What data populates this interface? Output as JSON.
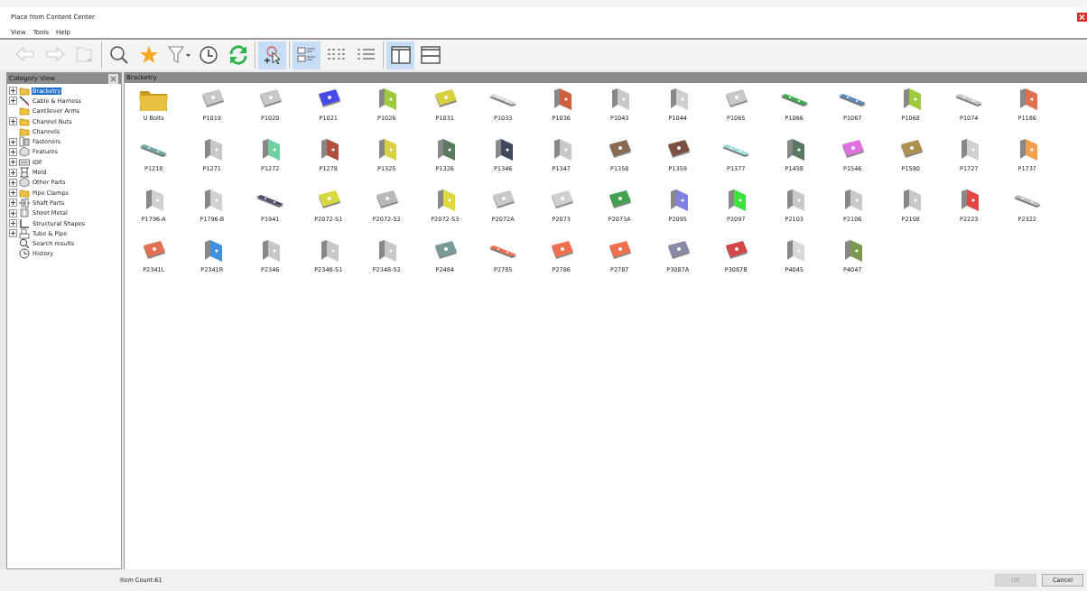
{
  "window": {
    "title": "Place from Content Center"
  },
  "menu": [
    "View",
    "Tools",
    "Help"
  ],
  "toolbar": [
    {
      "kind": "back",
      "disabled": true,
      "selected": false
    },
    {
      "kind": "forward",
      "disabled": true,
      "selected": false
    },
    {
      "kind": "folderup",
      "disabled": true,
      "selected": false
    },
    {
      "kind": "separator"
    },
    {
      "kind": "search",
      "disabled": false,
      "selected": false
    },
    {
      "kind": "star",
      "disabled": false,
      "selected": false
    },
    {
      "kind": "filter",
      "disabled": false,
      "selected": false
    },
    {
      "kind": "clock",
      "disabled": false,
      "selected": false
    },
    {
      "kind": "refresh",
      "disabled": false,
      "selected": false
    },
    {
      "kind": "separator"
    },
    {
      "kind": "place",
      "disabled": false,
      "selected": true
    },
    {
      "kind": "separator"
    },
    {
      "kind": "largelist",
      "disabled": false,
      "selected": true
    },
    {
      "kind": "smalllist",
      "disabled": false,
      "selected": false
    },
    {
      "kind": "detaillist",
      "disabled": false,
      "selected": false
    },
    {
      "kind": "separator"
    },
    {
      "kind": "splitvertical",
      "disabled": false,
      "selected": true
    },
    {
      "kind": "splithorizontal",
      "disabled": false,
      "selected": false
    }
  ],
  "sidebar": {
    "title": "Category View",
    "items": [
      {
        "label": "Bracketry",
        "kind": "folder",
        "expandable": true,
        "selected": true
      },
      {
        "label": "Cable & Harness",
        "kind": "cable",
        "expandable": true,
        "selected": false
      },
      {
        "label": "Cantilever Arms",
        "kind": "folder",
        "expandable": false,
        "selected": false
      },
      {
        "label": "Channel Nuts",
        "kind": "folder",
        "expandable": true,
        "selected": false
      },
      {
        "label": "Channels",
        "kind": "folder",
        "expandable": false,
        "selected": false
      },
      {
        "label": "Fasteners",
        "kind": "fastener",
        "expandable": true,
        "selected": false
      },
      {
        "label": "Features",
        "kind": "feature",
        "expandable": true,
        "selected": false
      },
      {
        "label": "IDF",
        "kind": "idf",
        "expandable": true,
        "selected": false
      },
      {
        "label": "Mold",
        "kind": "mold",
        "expandable": true,
        "selected": false
      },
      {
        "label": "Other Parts",
        "kind": "feature",
        "expandable": true,
        "selected": false
      },
      {
        "label": "Pipe Clamps",
        "kind": "folder",
        "expandable": true,
        "selected": false
      },
      {
        "label": "Shaft Parts",
        "kind": "shaft",
        "expandable": true,
        "selected": false
      },
      {
        "label": "Sheet Metal",
        "kind": "sheet",
        "expandable": true,
        "selected": false
      },
      {
        "label": "Structural Shapes",
        "kind": "structural",
        "expandable": true,
        "selected": false
      },
      {
        "label": "Tube & Pipe",
        "kind": "tube",
        "expandable": true,
        "selected": false
      },
      {
        "label": "Search results",
        "kind": "search",
        "expandable": false,
        "selected": false
      },
      {
        "label": "History",
        "kind": "history",
        "expandable": false,
        "selected": false
      }
    ]
  },
  "content": {
    "title": "Bracketry",
    "items": [
      {
        "label": "U Bolts",
        "kind": "folder",
        "color": "#e8c040"
      },
      {
        "label": "P1019",
        "kind": "plate",
        "color": "#c8c8c8"
      },
      {
        "label": "P1020",
        "kind": "plate",
        "color": "#c8c8c8"
      },
      {
        "label": "P1021",
        "kind": "plate",
        "color": "#4a4ae8"
      },
      {
        "label": "P1026",
        "kind": "angle",
        "color": "#9ccc3c"
      },
      {
        "label": "P1031",
        "kind": "plate",
        "color": "#d8d040"
      },
      {
        "label": "P1033",
        "kind": "strip",
        "color": "#d8d8d8"
      },
      {
        "label": "P1036",
        "kind": "angle",
        "color": "#d0603c"
      },
      {
        "label": "P1043",
        "kind": "angle",
        "color": "#c8c8c8"
      },
      {
        "label": "P1044",
        "kind": "angle",
        "color": "#d0d0d0"
      },
      {
        "label": "P1065",
        "kind": "plate",
        "color": "#c8c8c8"
      },
      {
        "label": "P1066",
        "kind": "strip",
        "color": "#3cb04c"
      },
      {
        "label": "P1067",
        "kind": "strip",
        "color": "#5a8cc0"
      },
      {
        "label": "P1068",
        "kind": "angle",
        "color": "#9ccc3c"
      },
      {
        "label": "P1074",
        "kind": "strip",
        "color": "#c8c8c8"
      },
      {
        "label": "P1186",
        "kind": "angle",
        "color": "#e07050"
      },
      {
        "label": "P1218",
        "kind": "strip",
        "color": "#70a8a8"
      },
      {
        "label": "P1271",
        "kind": "angle",
        "color": "#c8c8c8"
      },
      {
        "label": "P1272",
        "kind": "angle",
        "color": "#70d0a0"
      },
      {
        "label": "P1278",
        "kind": "angle",
        "color": "#b05040"
      },
      {
        "label": "P1325",
        "kind": "angle",
        "color": "#d8d040"
      },
      {
        "label": "P1326",
        "kind": "angle",
        "color": "#5a7a60"
      },
      {
        "label": "P1346",
        "kind": "angle",
        "color": "#404860"
      },
      {
        "label": "P1347",
        "kind": "angle",
        "color": "#c8c8c8"
      },
      {
        "label": "P1358",
        "kind": "plate",
        "color": "#8a6a50"
      },
      {
        "label": "P1359",
        "kind": "plate",
        "color": "#7a5040"
      },
      {
        "label": "P1377",
        "kind": "strip",
        "color": "#a0dcdc"
      },
      {
        "label": "P1458",
        "kind": "angle",
        "color": "#5a7a60"
      },
      {
        "label": "P1546",
        "kind": "plate",
        "color": "#e070e0"
      },
      {
        "label": "P1580",
        "kind": "plate",
        "color": "#b09050"
      },
      {
        "label": "P1727",
        "kind": "angle",
        "color": "#d0d0d0"
      },
      {
        "label": "P1737",
        "kind": "angle",
        "color": "#f0a050"
      },
      {
        "label": "P1796-A",
        "kind": "angle",
        "color": "#d0d0d0"
      },
      {
        "label": "P1796-B",
        "kind": "angle",
        "color": "#d0d0d0"
      },
      {
        "label": "P1941",
        "kind": "strip",
        "color": "#505070"
      },
      {
        "label": "P2072-S1",
        "kind": "plate",
        "color": "#d8d840"
      },
      {
        "label": "P2072-S2",
        "kind": "plate",
        "color": "#b8b8b8"
      },
      {
        "label": "P2072-S3",
        "kind": "angle",
        "color": "#e0d840"
      },
      {
        "label": "P2072A",
        "kind": "plate",
        "color": "#c8c8c8"
      },
      {
        "label": "P2073",
        "kind": "plate",
        "color": "#d0d0d0"
      },
      {
        "label": "P2073A",
        "kind": "plate",
        "color": "#40a050"
      },
      {
        "label": "P2095",
        "kind": "angle",
        "color": "#8080e0"
      },
      {
        "label": "P2097",
        "kind": "angle",
        "color": "#40e040"
      },
      {
        "label": "P2103",
        "kind": "angle",
        "color": "#c8c8c8"
      },
      {
        "label": "P2106",
        "kind": "angle",
        "color": "#c8c8c8"
      },
      {
        "label": "P2108",
        "kind": "angle",
        "color": "#c8c8c8"
      },
      {
        "label": "P2223",
        "kind": "angle",
        "color": "#e04848"
      },
      {
        "label": "P2322",
        "kind": "strip",
        "color": "#c0c0c0"
      },
      {
        "label": "P2341L",
        "kind": "plate",
        "color": "#e07050"
      },
      {
        "label": "P2341R",
        "kind": "angle",
        "color": "#4090e0"
      },
      {
        "label": "P2346",
        "kind": "angle",
        "color": "#c8c8c8"
      },
      {
        "label": "P2348-S1",
        "kind": "angle",
        "color": "#c8c8c8"
      },
      {
        "label": "P2348-S2",
        "kind": "angle",
        "color": "#c8c8c8"
      },
      {
        "label": "P2484",
        "kind": "plate",
        "color": "#7a9a98"
      },
      {
        "label": "P2785",
        "kind": "strip",
        "color": "#f07050"
      },
      {
        "label": "P2786",
        "kind": "plate",
        "color": "#f07050"
      },
      {
        "label": "P2787",
        "kind": "plate",
        "color": "#f07050"
      },
      {
        "label": "P3087A",
        "kind": "plate",
        "color": "#8a8aa8"
      },
      {
        "label": "P3087B",
        "kind": "plate",
        "color": "#d04848"
      },
      {
        "label": "P4045",
        "kind": "angle",
        "color": "#d8d8d8"
      },
      {
        "label": "P4047",
        "kind": "angle",
        "color": "#7a9a50"
      }
    ]
  },
  "status_bar": {
    "text": "Item Count:61"
  },
  "buttons": [
    {
      "label": "OK",
      "disabled": true
    },
    {
      "label": "Cancel",
      "disabled": false
    }
  ]
}
